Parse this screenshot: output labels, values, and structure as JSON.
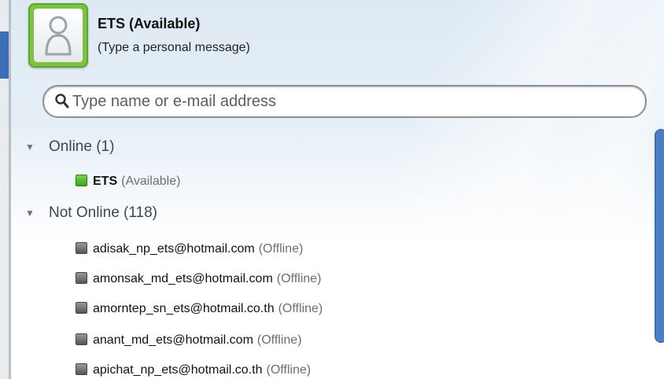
{
  "profile": {
    "status_name": "ETS (Available)",
    "personal_message": "(Type a personal message)",
    "frame_color": "#7dc242"
  },
  "search": {
    "placeholder": "Type name or e-mail address"
  },
  "groups": [
    {
      "label": "Online (1)",
      "expanded": true,
      "contacts": [
        {
          "name": "ETS",
          "status": "(Available)",
          "state": "online"
        }
      ]
    },
    {
      "label": "Not Online (118)",
      "expanded": true,
      "contacts": [
        {
          "name": "adisak_np_ets@hotmail.com",
          "status": "(Offline)",
          "state": "offline"
        },
        {
          "name": "amonsak_md_ets@hotmail.com",
          "status": "(Offline)",
          "state": "offline"
        },
        {
          "name": "amorntep_sn_ets@hotmail.co.th",
          "status": "(Offline)",
          "state": "offline"
        },
        {
          "name": "anant_md_ets@hotmail.com",
          "status": "(Offline)",
          "state": "offline"
        },
        {
          "name": "apichat_np_ets@hotmail.co.th",
          "status": "(Offline)",
          "state": "offline"
        }
      ]
    }
  ],
  "icons": {
    "avatar": "person-icon",
    "search": "search-icon",
    "expand": "triangle-down-icon",
    "online_status": "status-online-icon",
    "offline_status": "status-offline-icon"
  },
  "colors": {
    "online": "#4ab62a",
    "offline": "#6f6f6f",
    "scrollbar": "#4a7fc4"
  }
}
